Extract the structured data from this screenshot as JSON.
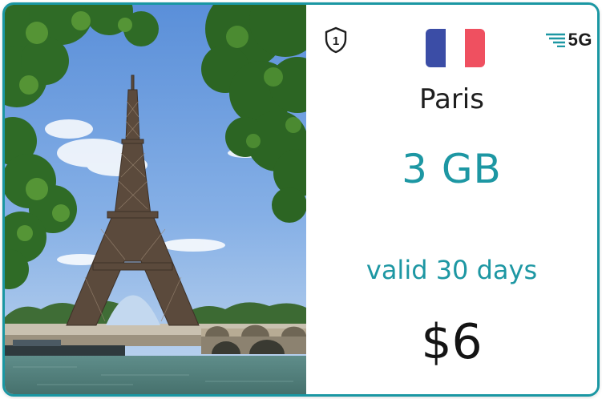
{
  "card": {
    "city": "Paris",
    "data_amount": "3 GB",
    "validity": "valid 30 days",
    "price": "$6",
    "network": "5G",
    "flag_colors": [
      "#3b4da6",
      "#ffffff",
      "#ef5060"
    ],
    "accent_color": "#1d97a3"
  },
  "icons": {
    "shield": "shield-number-icon",
    "shield_number": "1",
    "network": "signal-5g-icon",
    "flag": "france-flag-icon"
  },
  "photo": {
    "subject": "eiffel-tower-photo"
  }
}
